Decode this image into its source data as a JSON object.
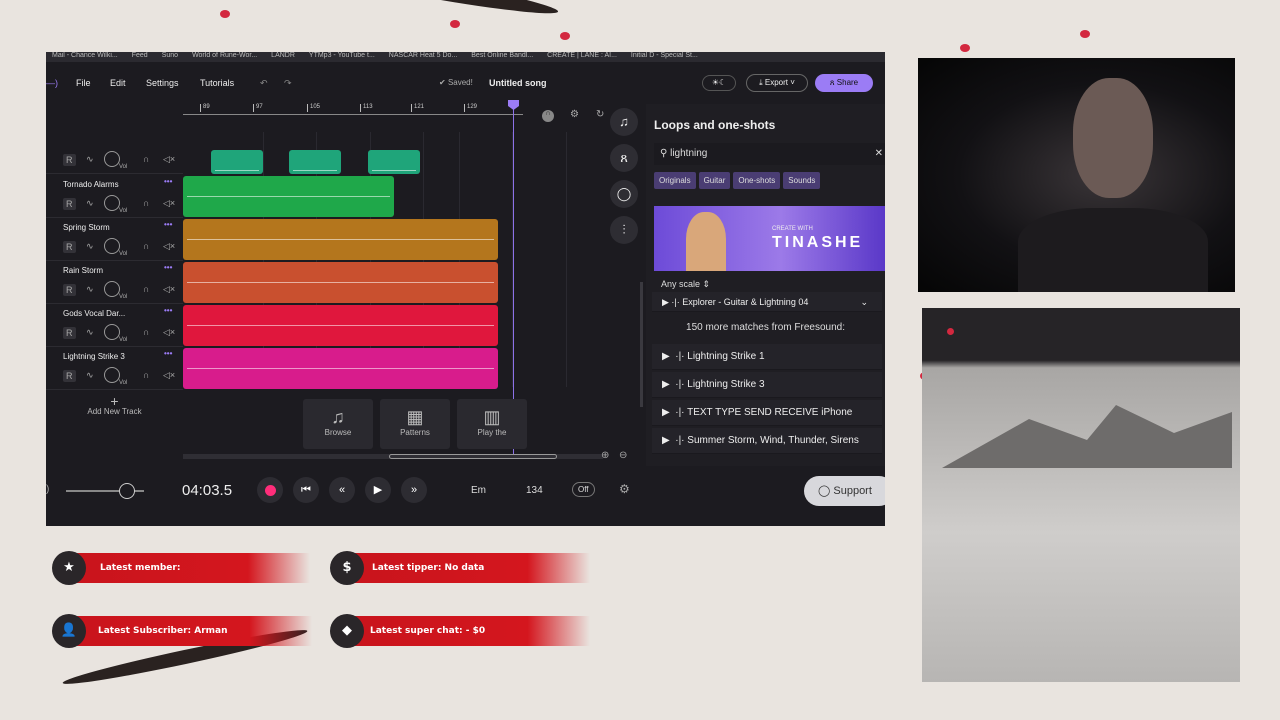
{
  "browser": {
    "bookmarks": [
      "Mail - Chance Wilki...",
      "Feed",
      "Suno",
      "World of Rune-Wor...",
      "LANDR",
      "YTMp3 - YouTube t...",
      "NASCAR Heat 5 Do...",
      "Best Online Bandl...",
      "CREATE | LANE : AI...",
      "Initial D - Special St..."
    ]
  },
  "menu": {
    "file": "File",
    "edit": "Edit",
    "settings": "Settings",
    "tutorials": "Tutorials"
  },
  "status": {
    "saved": "Saved!",
    "song_title": "Untitled song"
  },
  "actions": {
    "export": "Export",
    "share": "Share"
  },
  "ruler": [
    "89",
    "97",
    "105",
    "113",
    "121",
    "129"
  ],
  "tracks": [
    {
      "name": "",
      "color": "#1fa57a"
    },
    {
      "name": "Tornado Alarms",
      "color": "#1fa84a"
    },
    {
      "name": "Spring Storm",
      "color": "#b4761d"
    },
    {
      "name": "Rain Storm",
      "color": "#c9502f"
    },
    {
      "name": "Gods Vocal Dar...",
      "color": "#e0173d"
    },
    {
      "name": "Lightning Strike 3",
      "color": "#d81c8c"
    }
  ],
  "track_controls": {
    "record": "R",
    "vol": "Vol"
  },
  "add_track": "Add New Track",
  "quick": {
    "browse": "Browse",
    "patterns": "Patterns",
    "play": "Play the"
  },
  "panel": {
    "title": "Loops and one-shots",
    "search_value": "lightning",
    "filters": [
      "Originals",
      "Guitar",
      "One-shots",
      "Sounds"
    ],
    "promo_small": "CREATE WITH",
    "promo_big": "TINASHE",
    "scale": "Any scale",
    "top_result": "Explorer - Guitar & Lightning 04",
    "more": "150 more matches from Freesound:",
    "results": [
      "Lightning Strike 1",
      "Lightning Strike 3",
      "TEXT TYPE SEND RECEIVE iPhone",
      "Summer Storm, Wind, Thunder, Sirens"
    ]
  },
  "transport": {
    "time": "04:03.5",
    "key": "Em",
    "bpm": "134",
    "metronome": "Off",
    "support": "Support",
    "volume": 0.8
  },
  "overlay": {
    "member": "Latest member:",
    "tipper": "Latest tipper: No data",
    "subscriber": "Latest Subscriber: Arman",
    "superchat": "Latest super chat:  - $0"
  },
  "colors": {
    "accent": "#9b7cf5",
    "record": "#ff2d7a",
    "banner": "#d4161e"
  }
}
